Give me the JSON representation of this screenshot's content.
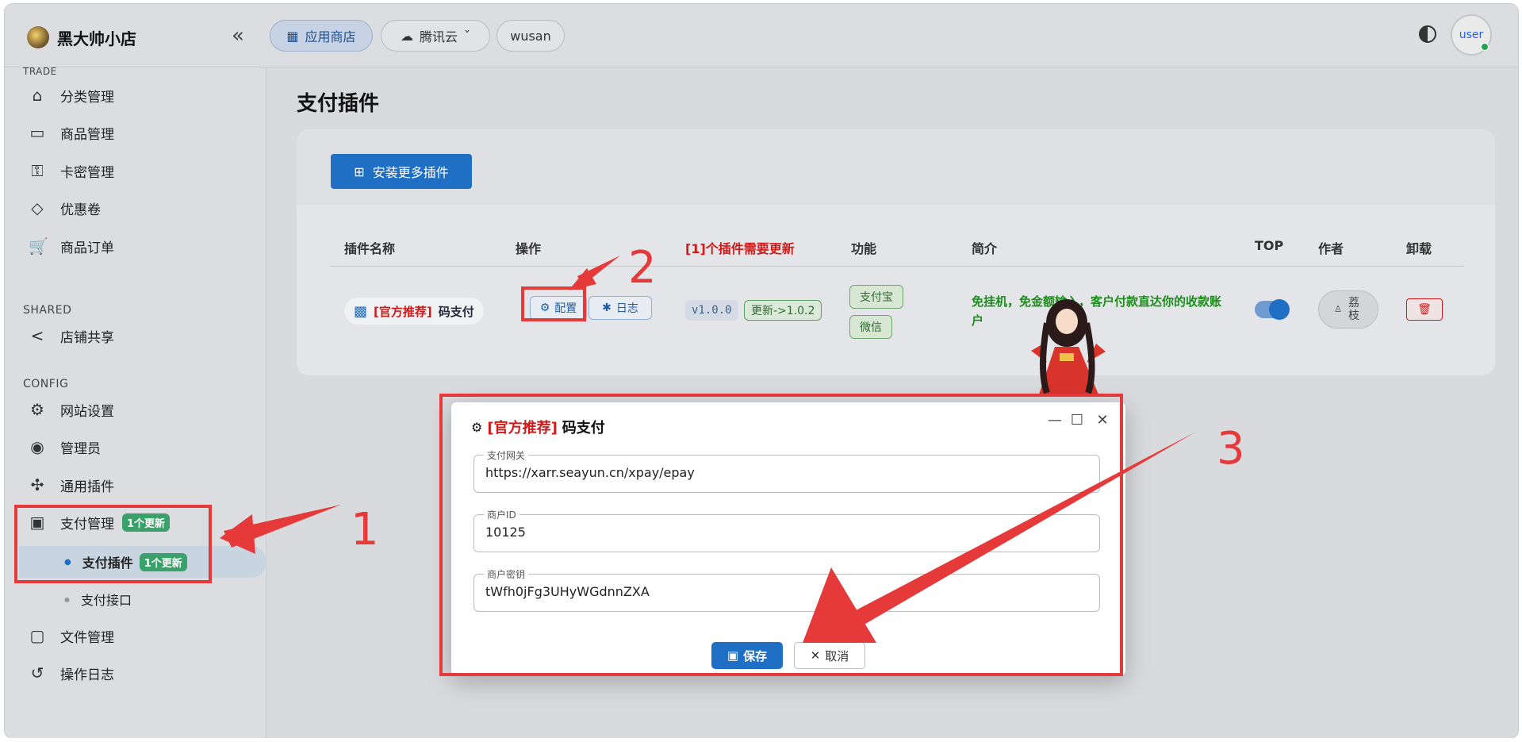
{
  "header": {
    "brand": "黑大帅小店",
    "collapse_icon": "«",
    "tabs": [
      {
        "label": "应用商店",
        "icon": "store-icon"
      },
      {
        "label": "腾讯云",
        "icon": "cloud-icon",
        "chevron": "ˇ"
      },
      {
        "label": "wusan"
      }
    ],
    "avatar_text": "user"
  },
  "sidebar": {
    "top_section": "TRADE",
    "trade_items": [
      {
        "label": "分类管理",
        "icon": "category-icon",
        "glyph": "⌂"
      },
      {
        "label": "商品管理",
        "icon": "archive-icon",
        "glyph": "▭"
      },
      {
        "label": "卡密管理",
        "icon": "key-icon",
        "glyph": "⚿"
      },
      {
        "label": "优惠卷",
        "icon": "tag-icon",
        "glyph": "◇"
      },
      {
        "label": "商品订单",
        "icon": "cart-icon",
        "glyph": "🛒"
      }
    ],
    "shared_section": "SHARED",
    "shared_items": [
      {
        "label": "店铺共享",
        "icon": "share-icon",
        "glyph": "<"
      }
    ],
    "config_section": "CONFIG",
    "config_items": [
      {
        "label": "网站设置",
        "icon": "gear-icon",
        "glyph": "⚙"
      },
      {
        "label": "管理员",
        "icon": "admin-icon",
        "glyph": "◉"
      },
      {
        "label": "通用插件",
        "icon": "puzzle-icon",
        "glyph": "✣"
      }
    ],
    "payment": {
      "label": "支付管理",
      "icon": "payment-icon",
      "glyph": "▣",
      "badge": "1个更新"
    },
    "payment_sub": [
      {
        "label": "支付插件",
        "badge": "1个更新"
      },
      {
        "label": "支付接口"
      }
    ],
    "bottom_items": [
      {
        "label": "文件管理",
        "icon": "folder-icon",
        "glyph": "▢"
      },
      {
        "label": "操作日志",
        "icon": "history-icon",
        "glyph": "↺"
      }
    ]
  },
  "main": {
    "title": "支付插件",
    "install_button": "安装更多插件",
    "columns": [
      "插件名称",
      "操作",
      "[1]个插件需要更新",
      "功能",
      "简介",
      "TOP",
      "作者",
      "卸载"
    ],
    "row": {
      "tag": "[官方推荐]",
      "name": "码支付",
      "config_btn": "配置",
      "log_btn": "日志",
      "version": "v1.0.0",
      "update": "更新->1.0.2",
      "functions": [
        "支付宝",
        "微信"
      ],
      "desc": "免挂机，免金额输入，客户付款直达你的收款账户",
      "top_enabled": true,
      "author": "荔枝"
    }
  },
  "modal": {
    "tag": "[官方推荐]",
    "name": "码支付",
    "fields": [
      {
        "label": "支付网关",
        "value": "https://xarr.seayun.cn/xpay/epay"
      },
      {
        "label": "商户ID",
        "value": "10125"
      },
      {
        "label": "商户密钥",
        "value": "tWfh0jFg3UHyWGdnnZXA"
      }
    ],
    "save": "保存",
    "cancel": "取消"
  },
  "annotations": [
    "1",
    "2",
    "3"
  ],
  "colors": {
    "accent": "#1f6fc4",
    "annotation": "#e63a3a",
    "success": "#3aa16b",
    "danger": "#d11a1a"
  }
}
